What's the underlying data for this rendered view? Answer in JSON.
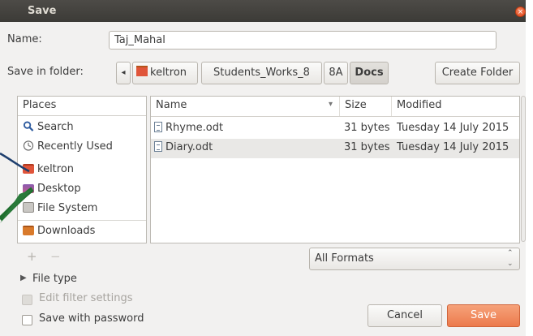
{
  "window": {
    "title": "Save",
    "close_glyph": "×"
  },
  "name_row": {
    "label": "Name:",
    "value": "Taj_Mahal"
  },
  "folder_row": {
    "label": "Save in folder:",
    "back_glyph": "◂",
    "path": [
      "keltron",
      "Students_Works_8",
      "8A",
      "Docs"
    ],
    "create_folder": "Create Folder"
  },
  "places": {
    "header": "Places",
    "items": [
      {
        "label": "Search",
        "icon": "search-icon"
      },
      {
        "label": "Recently Used",
        "icon": "clock-icon"
      },
      {
        "label": "keltron",
        "icon": "home-folder-icon"
      },
      {
        "label": "Desktop",
        "icon": "desktop-icon"
      },
      {
        "label": "File System",
        "icon": "drive-icon"
      },
      {
        "label": "Downloads",
        "icon": "downloads-folder-icon"
      }
    ],
    "add_glyph": "+",
    "remove_glyph": "−"
  },
  "files": {
    "columns": {
      "name": "Name",
      "sort_glyph": "▾",
      "size": "Size",
      "modified": "Modified"
    },
    "rows": [
      {
        "name": "Rhyme.odt",
        "size": "31 bytes",
        "modified": "Tuesday 14 July 2015"
      },
      {
        "name": "Diary.odt",
        "size": "31 bytes",
        "modified": "Tuesday 14 July 2015"
      }
    ]
  },
  "filter": {
    "value": "All Formats",
    "spinner_glyph": "⌃⌄"
  },
  "options": {
    "file_type_glyph": "▶",
    "file_type": "File type",
    "edit_filter": "Edit filter settings",
    "save_password": "Save with password"
  },
  "actions": {
    "cancel": "Cancel",
    "save": "Save"
  },
  "colors": {
    "accent": "#f08a5d",
    "selected_row": "#e9e8e6",
    "titlebar": "#3c3b37"
  }
}
